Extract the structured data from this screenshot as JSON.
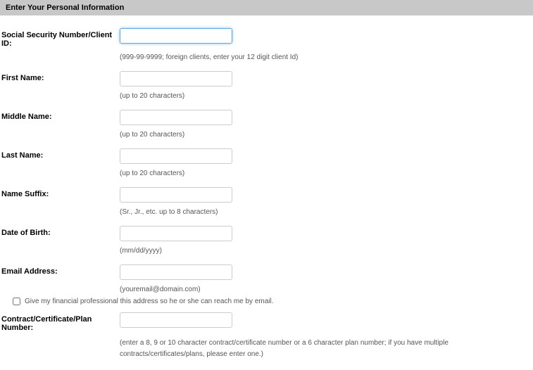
{
  "header": {
    "title": "Enter Your Personal Information"
  },
  "fields": {
    "ssn": {
      "label": "Social Security Number/Client ID:",
      "value": "",
      "hint": "(999-99-9999; foreign clients, enter your 12 digit client Id)"
    },
    "first_name": {
      "label": "First Name:",
      "value": "",
      "hint": "(up to 20 characters)"
    },
    "middle_name": {
      "label": "Middle Name:",
      "value": "",
      "hint": "(up to 20 characters)"
    },
    "last_name": {
      "label": "Last Name:",
      "value": "",
      "hint": "(up to 20 characters)"
    },
    "suffix": {
      "label": "Name Suffix:",
      "value": "",
      "hint": "(Sr., Jr., etc. up to 8 characters)"
    },
    "dob": {
      "label": "Date of Birth:",
      "value": "",
      "hint": "(mm/dd/yyyy)"
    },
    "email": {
      "label": "Email Address:",
      "value": "",
      "hint": "(youremail@domain.com)"
    },
    "share_checkbox": {
      "label": "Give my financial professional this address so he or she can reach me by email."
    },
    "contract": {
      "label": "Contract/Certificate/Plan Number:",
      "value": "",
      "hint": "(enter a 8, 9 or 10 character contract/certificate number or a 6 character plan number; if you have multiple contracts/certificates/plans, please enter one.)"
    }
  }
}
